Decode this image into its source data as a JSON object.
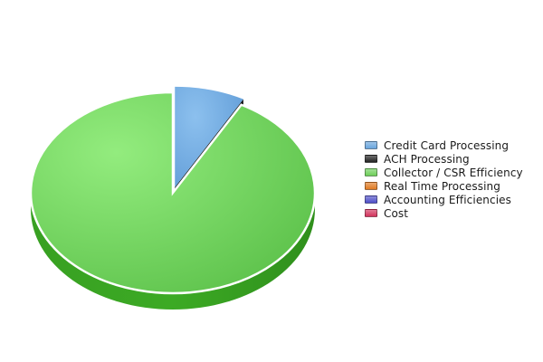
{
  "chart_data": {
    "type": "pie",
    "style": "3d-exploded",
    "slices": [
      {
        "name": "Credit Card Processing",
        "value": 8,
        "color": "#6aa6dd"
      },
      {
        "name": "ACH Processing",
        "value": 0,
        "color": "#222222"
      },
      {
        "name": "Collector / CSR Efficiency",
        "value": 92,
        "color": "#6ecf5a"
      },
      {
        "name": "Real Time Processing",
        "value": 0,
        "color": "#e07a22"
      },
      {
        "name": "Accounting Efficiencies",
        "value": 0,
        "color": "#4f4fc8"
      },
      {
        "name": "Cost",
        "value": 0,
        "color": "#d2335c"
      }
    ],
    "exploded": [
      "Credit Card Processing"
    ],
    "legend_position": "right"
  }
}
